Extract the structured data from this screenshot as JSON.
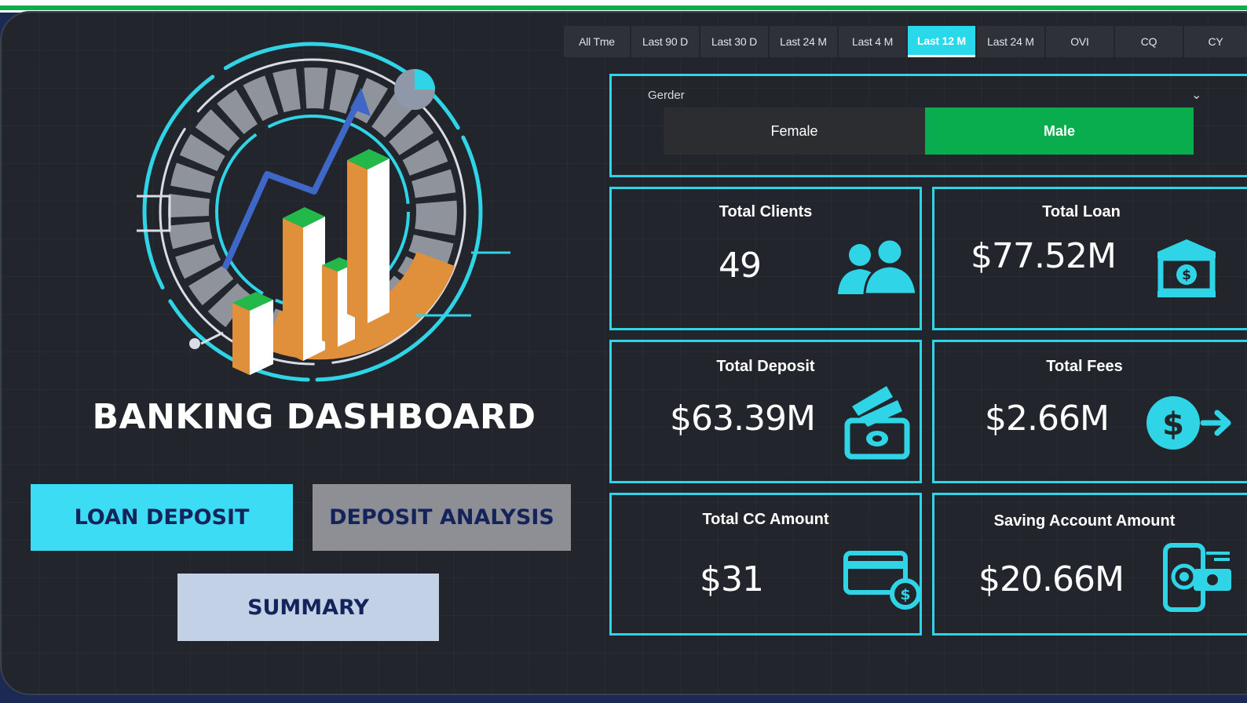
{
  "time_filters": [
    {
      "label": "All Tme",
      "active": false
    },
    {
      "label": "Last 90 D",
      "active": false
    },
    {
      "label": "Last 30 D",
      "active": false
    },
    {
      "label": "Last 24 M",
      "active": false
    },
    {
      "label": "Last 4 M",
      "active": false
    },
    {
      "label": "Last 12 M",
      "active": true
    },
    {
      "label": "Last 24 M",
      "active": false
    },
    {
      "label": "OVI",
      "active": false
    },
    {
      "label": "CQ",
      "active": false
    },
    {
      "label": "CY",
      "active": false
    }
  ],
  "gender": {
    "label": "Gerder",
    "options": [
      "Female",
      "Male"
    ],
    "selected": "Male"
  },
  "brand_title": "BANKING DASHBOARD",
  "nav": {
    "loan_deposit": "LOAN DEPOSIT",
    "deposit_analysis": "DEPOSIT ANALYSIS",
    "summary": "SUMMARY"
  },
  "kpis": {
    "total_clients": {
      "title": "Total Clients",
      "value": "49",
      "icon": "users-icon"
    },
    "total_loan": {
      "title": "Total Loan",
      "value": "$77.52M",
      "icon": "bank-icon"
    },
    "total_deposit": {
      "title": "Total Deposit",
      "value": "$63.39M",
      "icon": "cash-deposit-icon"
    },
    "total_fees": {
      "title": "Total Fees",
      "value": "$2.66M",
      "icon": "dollar-transfer-icon"
    },
    "total_cc_amount": {
      "title": "Total CC Amount",
      "value": "$31",
      "icon": "credit-card-icon"
    },
    "saving_account_amount": {
      "title": "Saving Account Amount",
      "value": "$20.66M",
      "icon": "mobile-savings-icon"
    }
  },
  "colors": {
    "accent": "#2fd4e6",
    "active_green": "#0aad4d",
    "panel_bg": "#22252b",
    "nav_cyan": "#3cdcf4",
    "nav_gray": "#8d8f94",
    "nav_light": "#c3d1e6",
    "brand_text": "#14245a"
  }
}
